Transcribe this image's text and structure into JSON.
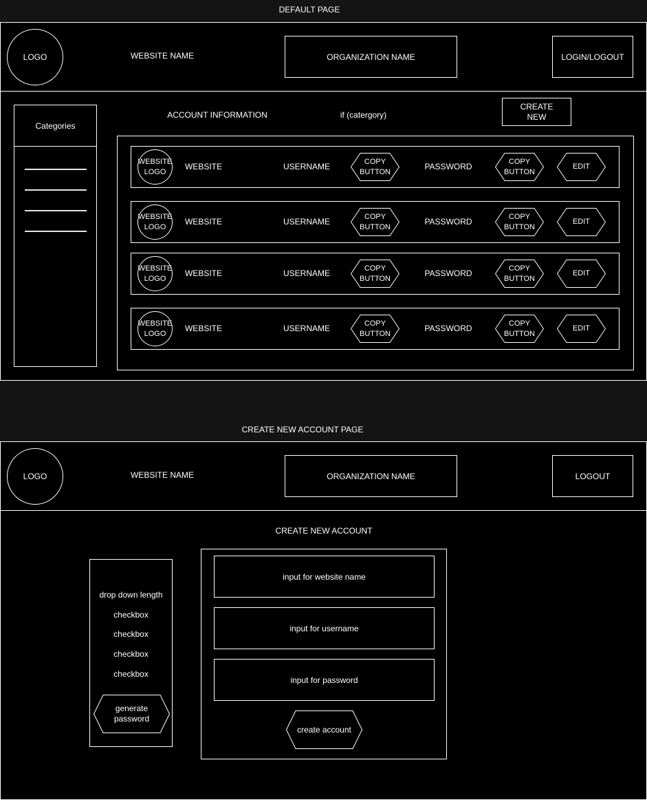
{
  "default_page": {
    "title": "DEFAULT PAGE",
    "header": {
      "logo": "LOGO",
      "website_name": "WEBSITE NAME",
      "organization_name": "ORGANIZATION NAME",
      "login_button": "LOGIN/LOGOUT"
    },
    "sidebar": {
      "title": "Categories",
      "items": [
        "",
        "",
        "",
        ""
      ]
    },
    "account_info_label": "ACCOUNT INFORMATION",
    "category_label": "if (catergory)",
    "create_new_button": "CREATE\nNEW",
    "rows": [
      {
        "logo": "WEBSITE\nLOGO",
        "website": "WEBSITE",
        "username": "USERNAME",
        "copy1": "COPY\nBUTTON",
        "password": "PASSWORD",
        "copy2": "COPY\nBUTTON",
        "edit": "EDIT"
      },
      {
        "logo": "WEBSITE\nLOGO",
        "website": "WEBSITE",
        "username": "USERNAME",
        "copy1": "COPY\nBUTTON",
        "password": "PASSWORD",
        "copy2": "COPY\nBUTTON",
        "edit": "EDIT"
      },
      {
        "logo": "WEBSITE\nLOGO",
        "website": "WEBSITE",
        "username": "USERNAME",
        "copy1": "COPY\nBUTTON",
        "password": "PASSWORD",
        "copy2": "COPY\nBUTTON",
        "edit": "EDIT"
      },
      {
        "logo": "WEBSITE\nLOGO",
        "website": "WEBSITE",
        "username": "USERNAME",
        "copy1": "COPY\nBUTTON",
        "password": "PASSWORD",
        "copy2": "COPY\nBUTTON",
        "edit": "EDIT"
      }
    ]
  },
  "create_page": {
    "title": "CREATE NEW ACCOUNT PAGE",
    "header": {
      "logo": "LOGO",
      "website_name": "WEBSITE NAME",
      "organization_name": "ORGANIZATION NAME",
      "logout_button": "LOGOUT"
    },
    "heading": "CREATE NEW ACCOUNT",
    "generator": {
      "dropdown": "drop down length",
      "checkboxes": [
        "checkbox",
        "checkbox",
        "checkbox",
        "checkbox"
      ],
      "generate_button": "generate\npassword"
    },
    "form": {
      "website_input": "input for website name",
      "username_input": "input for username",
      "password_input": "input for password",
      "submit_button": "create account"
    }
  }
}
